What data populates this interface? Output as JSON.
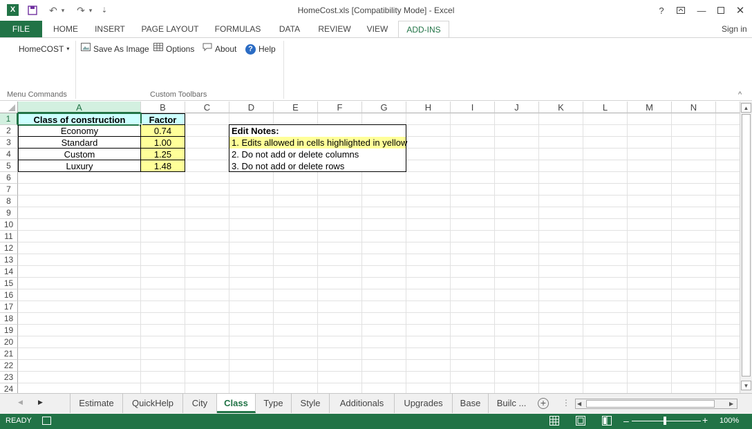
{
  "window": {
    "title": "HomeCost.xls  [Compatibility Mode] - Excel",
    "sign_in": "Sign in"
  },
  "ribbon_tabs": [
    "FILE",
    "HOME",
    "INSERT",
    "PAGE LAYOUT",
    "FORMULAS",
    "DATA",
    "REVIEW",
    "VIEW",
    "ADD-INS"
  ],
  "ribbon": {
    "homecost_menu": "HomeCOST",
    "menu_group_label": "Menu Commands",
    "save_as_image": "Save As Image",
    "options": "Options",
    "about": "About",
    "help": "Help",
    "toolbar_group_label": "Custom Toolbars"
  },
  "columns": [
    "A",
    "B",
    "C",
    "D",
    "E",
    "F",
    "G",
    "H",
    "I",
    "J",
    "K",
    "L",
    "M",
    "N"
  ],
  "rows": [
    "1",
    "2",
    "3",
    "4",
    "5",
    "6",
    "7",
    "8",
    "9",
    "10",
    "11",
    "12",
    "13",
    "14",
    "15",
    "16",
    "17",
    "18",
    "19",
    "20",
    "21",
    "22",
    "23",
    "24"
  ],
  "table": {
    "header_class": "Class of construction",
    "header_factor": "Factor",
    "rows": [
      {
        "class": "Economy",
        "factor": "0.74"
      },
      {
        "class": "Standard",
        "factor": "1.00"
      },
      {
        "class": "Custom",
        "factor": "1.25"
      },
      {
        "class": "Luxury",
        "factor": "1.48"
      }
    ]
  },
  "notes": {
    "title": "Edit Notes:",
    "line1": "1. Edits allowed in cells highlighted in yellow",
    "line2": "2. Do not add or delete columns",
    "line3": "3. Do not add or delete rows"
  },
  "sheets": [
    "Estimate",
    "QuickHelp",
    "City",
    "Class",
    "Type",
    "Style",
    "Additionals",
    "Upgrades",
    "Base",
    "Builc ..."
  ],
  "active_sheet": "Class",
  "status": {
    "ready": "READY",
    "zoom": "100%"
  },
  "colors": {
    "accent": "#217346",
    "yellow_cell": "#ffff99",
    "header_cyan": "#ccffff"
  }
}
